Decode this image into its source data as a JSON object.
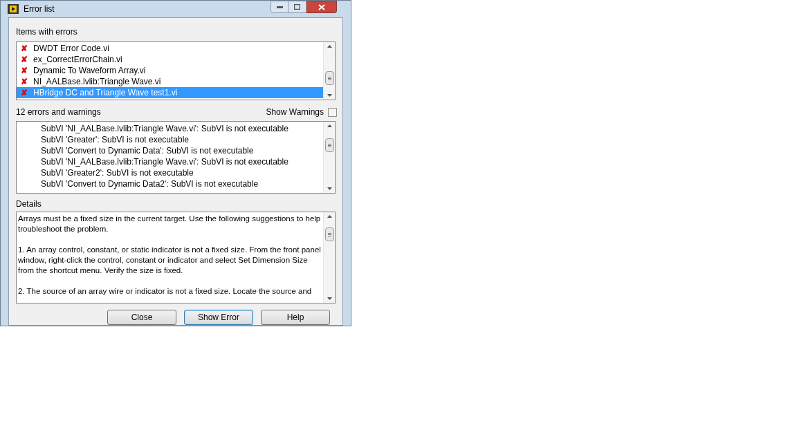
{
  "window": {
    "title": "Error list"
  },
  "items_with_errors": {
    "label": "Items with errors",
    "items": [
      {
        "icon": "✘",
        "name": "DWDT Error Code.vi",
        "selected": false
      },
      {
        "icon": "✘",
        "name": "ex_CorrectErrorChain.vi",
        "selected": false
      },
      {
        "icon": "✘",
        "name": "Dynamic To Waveform Array.vi",
        "selected": false
      },
      {
        "icon": "✘",
        "name": "NI_AALBase.lvlib:Triangle Wave.vi",
        "selected": false
      },
      {
        "icon": "✘",
        "name": "HBridge DC and Triangle Wave test1.vi",
        "selected": true
      }
    ]
  },
  "errors": {
    "count_label": "12 errors and warnings",
    "show_warnings": {
      "label": "Show Warnings",
      "checked": false
    },
    "items": [
      "SubVI 'NI_AALBase.lvlib:Triangle Wave.vi': SubVI is not executable",
      "SubVI 'Greater': SubVI is not executable",
      "SubVI 'Convert to Dynamic Data': SubVI is not executable",
      "SubVI 'NI_AALBase.lvlib:Triangle Wave.vi': SubVI is not executable",
      "SubVI 'Greater2': SubVI is not executable",
      "SubVI 'Convert to Dynamic Data2': SubVI is not executable"
    ]
  },
  "details": {
    "label": "Details",
    "paragraphs": [
      "Arrays must be a fixed size in the current target. Use the following suggestions to help troubleshoot the problem.",
      "1. An array control, constant, or static indicator is not a fixed size. From the front panel window, right-click the control, constant or indicator and select Set Dimension Size from the shortcut menu. Verify the size is fixed.",
      "2.  The source of an array wire or indicator is not a fixed size. Locate the source and"
    ]
  },
  "buttons": [
    {
      "label": "Close",
      "default": false
    },
    {
      "label": "Show Error",
      "default": true
    },
    {
      "label": "Help",
      "default": false
    }
  ]
}
